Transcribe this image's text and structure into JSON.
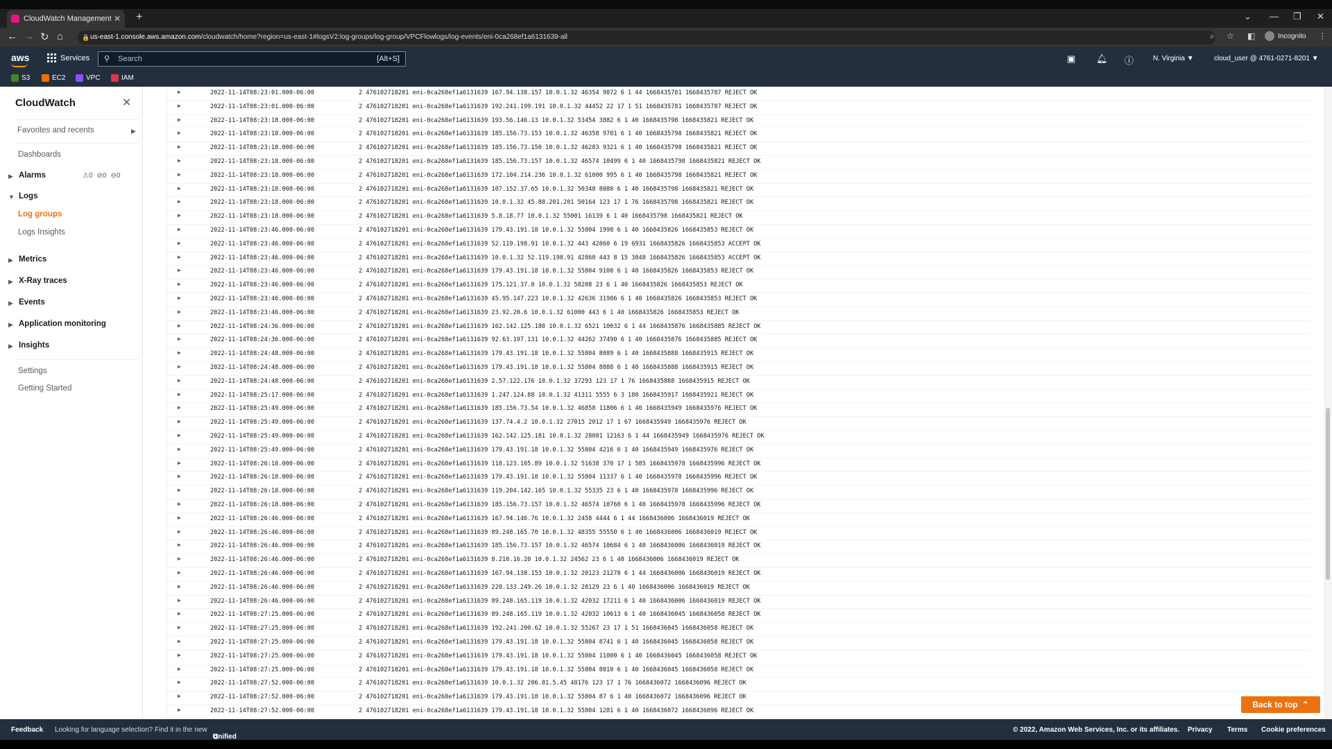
{
  "browser": {
    "tab_title": "CloudWatch Management Cons",
    "new_tab": "+",
    "url_host": "us-east-1.console.aws.amazon.com",
    "url_path": "/cloudwatch/home?region=us-east-1#logsV2:log-groups/log-group/VPCFlowlogs/log-events/eni-0ca268ef1a6131639-all",
    "incognito_label": "Incognito"
  },
  "aws_nav": {
    "logo": "aws",
    "services_label": "Services",
    "search_placeholder": "Search",
    "search_shortcut": "[Alt+S]",
    "region": "N. Virginia ▼",
    "account": "cloud_user @ 4761-0271-8201 ▼"
  },
  "favorites_bar": [
    {
      "label": "S3",
      "color": "#3f8624"
    },
    {
      "label": "EC2",
      "color": "#ed7100"
    },
    {
      "label": "VPC",
      "color": "#8c4fff"
    },
    {
      "label": "IAM",
      "color": "#dd344c"
    }
  ],
  "sidebar": {
    "title": "CloudWatch",
    "favorites": "Favorites and recents",
    "dashboards": "Dashboards",
    "alarms": "Alarms",
    "alarm_counts": [
      "0",
      "0",
      "0"
    ],
    "logs": "Logs",
    "log_groups": "Log groups",
    "logs_insights": "Logs Insights",
    "metrics": "Metrics",
    "xray": "X-Ray traces",
    "events": "Events",
    "app_monitoring": "Application monitoring",
    "insights": "Insights",
    "settings": "Settings",
    "getting_started": "Getting Started"
  },
  "log_events": [
    {
      "ts": "2022-11-14T08:23:01.000-06:00",
      "msg": "2 476102718201 eni-0ca268ef1a6131639 167.94.138.157 10.0.1.32 46354 9872 6 1 44 1668435781 1668435787 REJECT OK"
    },
    {
      "ts": "2022-11-14T08:23:01.000-06:00",
      "msg": "2 476102718201 eni-0ca268ef1a6131639 192.241.199.191 10.0.1.32 44452 22 17 1 51 1668435781 1668435787 REJECT OK"
    },
    {
      "ts": "2022-11-14T08:23:18.000-06:00",
      "msg": "2 476102718201 eni-0ca268ef1a6131639 193.56.146.13 10.0.1.32 53454 3882 6 1 40 1668435798 1668435821 REJECT OK"
    },
    {
      "ts": "2022-11-14T08:23:18.000-06:00",
      "msg": "2 476102718201 eni-0ca268ef1a6131639 185.156.73.153 10.0.1.32 46358 9701 6 1 40 1668435798 1668435821 REJECT OK"
    },
    {
      "ts": "2022-11-14T08:23:18.000-06:00",
      "msg": "2 476102718201 eni-0ca268ef1a6131639 185.156.73.150 10.0.1.32 46283 9321 6 1 40 1668435798 1668435821 REJECT OK"
    },
    {
      "ts": "2022-11-14T08:23:18.000-06:00",
      "msg": "2 476102718201 eni-0ca268ef1a6131639 185.156.73.157 10.0.1.32 46574 10499 6 1 40 1668435798 1668435821 REJECT OK"
    },
    {
      "ts": "2022-11-14T08:23:18.000-06:00",
      "msg": "2 476102718201 eni-0ca268ef1a6131639 172.104.214.236 10.0.1.32 61000 995 6 1 40 1668435798 1668435821 REJECT OK"
    },
    {
      "ts": "2022-11-14T08:23:18.000-06:00",
      "msg": "2 476102718201 eni-0ca268ef1a6131639 107.152.37.65 10.0.1.32 50348 8080 6 1 40 1668435798 1668435821 REJECT OK"
    },
    {
      "ts": "2022-11-14T08:23:18.000-06:00",
      "msg": "2 476102718201 eni-0ca268ef1a6131639 10.0.1.32 45.88.201.201 50164 123 17 1 76 1668435798 1668435821 REJECT OK"
    },
    {
      "ts": "2022-11-14T08:23:18.000-06:00",
      "msg": "2 476102718201 eni-0ca268ef1a6131639 5.8.18.77 10.0.1.32 55001 16139 6 1 40 1668435798 1668435821 REJECT OK"
    },
    {
      "ts": "2022-11-14T08:23:46.000-06:00",
      "msg": "2 476102718201 eni-0ca268ef1a6131639 179.43.191.18 10.0.1.32 55804 1998 6 1 40 1668435826 1668435853 REJECT OK"
    },
    {
      "ts": "2022-11-14T08:23:46.000-06:00",
      "msg": "2 476102718201 eni-0ca268ef1a6131639 52.119.198.91 10.0.1.32 443 42860 6 19 6931 1668435826 1668435853 ACCEPT OK"
    },
    {
      "ts": "2022-11-14T08:23:46.000-06:00",
      "msg": "2 476102718201 eni-0ca268ef1a6131639 10.0.1.32 52.119.198.91 42860 443 8 15 3048 1668435826 1668435853 ACCEPT OK"
    },
    {
      "ts": "2022-11-14T08:23:46.000-06:00",
      "msg": "2 476102718201 eni-0ca268ef1a6131639 179.43.191.18 10.0.1.32 55804 9100 6 1 40 1668435826 1668435853 REJECT OK"
    },
    {
      "ts": "2022-11-14T08:23:46.000-06:00",
      "msg": "2 476102718201 eni-0ca268ef1a6131639 175.121.37.8 10.0.1.32 58208 23 6 1 40 1668435826 1668435853 REJECT OK"
    },
    {
      "ts": "2022-11-14T08:23:46.000-06:00",
      "msg": "2 476102718201 eni-0ca268ef1a6131639 45.95.147.223 10.0.1.32 42636 31986 6 1 40 1668435826 1668435853 REJECT OK"
    },
    {
      "ts": "2022-11-14T08:23:46.000-06:00",
      "msg": "2 476102718201 eni-0ca268ef1a6131639 23.92.20.6 10.0.1.32 61000 443 6 1 40 1668435826 1668435853 REJECT OK"
    },
    {
      "ts": "2022-11-14T08:24:36.000-06:00",
      "msg": "2 476102718201 eni-0ca268ef1a6131639 162.142.125.180 10.0.1.32 6521 10032 6 1 44 1668435876 1668435885 REJECT OK"
    },
    {
      "ts": "2022-11-14T08:24:36.000-06:00",
      "msg": "2 476102718201 eni-0ca268ef1a6131639 92.63.197.131 10.0.1.32 44262 37490 6 1 40 1668435876 1668435885 REJECT OK"
    },
    {
      "ts": "2022-11-14T08:24:48.000-06:00",
      "msg": "2 476102718201 eni-0ca268ef1a6131639 179.43.191.18 10.0.1.32 55804 8089 6 1 40 1668435888 1668435915 REJECT OK"
    },
    {
      "ts": "2022-11-14T08:24:48.000-06:00",
      "msg": "2 476102718201 eni-0ca268ef1a6131639 179.43.191.18 10.0.1.32 55804 8888 6 1 40 1668435888 1668435915 REJECT OK"
    },
    {
      "ts": "2022-11-14T08:24:48.000-06:00",
      "msg": "2 476102718201 eni-0ca268ef1a6131639 2.57.122.176 10.0.1.32 37293 123 17 1 76 1668435888 1668435915 REJECT OK"
    },
    {
      "ts": "2022-11-14T08:25:17.000-06:00",
      "msg": "2 476102718201 eni-0ca268ef1a6131639 1.247.124.88 10.0.1.32 41311 5555 6 3 180 1668435917 1668435921 REJECT OK"
    },
    {
      "ts": "2022-11-14T08:25:49.000-06:00",
      "msg": "2 476102718201 eni-0ca268ef1a6131639 185.156.73.54 10.0.1.32 46858 11806 6 1 40 1668435949 1668435976 REJECT OK"
    },
    {
      "ts": "2022-11-14T08:25:49.000-06:00",
      "msg": "2 476102718201 eni-0ca268ef1a6131639 137.74.4.2 10.0.1.32 27015 2012 17 1 67 1668435949 1668435976 REJECT OK"
    },
    {
      "ts": "2022-11-14T08:25:49.000-06:00",
      "msg": "2 476102718201 eni-0ca268ef1a6131639 162.142.125.181 10.0.1.32 28081 12163 6 1 44 1668435949 1668435976 REJECT OK"
    },
    {
      "ts": "2022-11-14T08:25:49.000-06:00",
      "msg": "2 476102718201 eni-0ca268ef1a6131639 179.43.191.18 10.0.1.32 55804 4216 6 1 40 1668435949 1668435976 REJECT OK"
    },
    {
      "ts": "2022-11-14T08:26:18.000-06:00",
      "msg": "2 476102718201 eni-0ca268ef1a6131639 118.123.105.89 10.0.1.32 51638 370 17 1 585 1668435978 1668435996 REJECT OK"
    },
    {
      "ts": "2022-11-14T08:26:18.000-06:00",
      "msg": "2 476102718201 eni-0ca268ef1a6131639 179.43.191.18 10.0.1.32 55804 11337 6 1 40 1668435978 1668435996 REJECT OK"
    },
    {
      "ts": "2022-11-14T08:26:18.000-06:00",
      "msg": "2 476102718201 eni-0ca268ef1a6131639 119.204.142.165 10.0.1.32 55335 23 6 1 40 1668435978 1668435996 REJECT OK"
    },
    {
      "ts": "2022-11-14T08:26:18.000-06:00",
      "msg": "2 476102718201 eni-0ca268ef1a6131639 185.156.73.157 10.0.1.32 46574 10768 6 1 40 1668435978 1668435996 REJECT OK"
    },
    {
      "ts": "2022-11-14T08:26:46.000-06:00",
      "msg": "2 476102718201 eni-0ca268ef1a6131639 167.94.146.76 10.0.1.32 2458 4444 6 1 44 1668436006 1668436019 REJECT OK"
    },
    {
      "ts": "2022-11-14T08:26:46.000-06:00",
      "msg": "2 476102718201 eni-0ca268ef1a6131639 89.248.165.70 10.0.1.32 48355 55550 6 1 40 1668436006 1668436019 REJECT OK"
    },
    {
      "ts": "2022-11-14T08:26:46.000-06:00",
      "msg": "2 476102718201 eni-0ca268ef1a6131639 185.156.73.157 10.0.1.32 46574 10684 6 1 40 1668436006 1668436019 REJECT OK"
    },
    {
      "ts": "2022-11-14T08:26:46.000-06:00",
      "msg": "2 476102718201 eni-0ca268ef1a6131639 8.210.16.20 10.0.1.32 24562 23 6 1 40 1668436006 1668436019 REJECT OK"
    },
    {
      "ts": "2022-11-14T08:26:46.000-06:00",
      "msg": "2 476102718201 eni-0ca268ef1a6131639 167.94.138.153 10.0.1.32 20123 21278 6 1 44 1668436006 1668436019 REJECT OK"
    },
    {
      "ts": "2022-11-14T08:26:46.000-06:00",
      "msg": "2 476102718201 eni-0ca268ef1a6131639 220.133.249.26 10.0.1.32 28129 23 6 1 40 1668436006 1668436019 REJECT OK"
    },
    {
      "ts": "2022-11-14T08:26:46.000-06:00",
      "msg": "2 476102718201 eni-0ca268ef1a6131639 89.248.165.119 10.0.1.32 42032 17211 6 1 40 1668436006 1668436019 REJECT OK"
    },
    {
      "ts": "2022-11-14T08:27:25.000-06:00",
      "msg": "2 476102718201 eni-0ca268ef1a6131639 89.248.165.119 10.0.1.32 42032 10613 6 1 40 1668436045 1668436058 REJECT OK"
    },
    {
      "ts": "2022-11-14T08:27:25.000-06:00",
      "msg": "2 476102718201 eni-0ca268ef1a6131639 192.241.200.62 10.0.1.32 55267 23 17 1 51 1668436045 1668436058 REJECT OK"
    },
    {
      "ts": "2022-11-14T08:27:25.000-06:00",
      "msg": "2 476102718201 eni-0ca268ef1a6131639 179.43.191.18 10.0.1.32 55804 8741 6 1 40 1668436045 1668436058 REJECT OK"
    },
    {
      "ts": "2022-11-14T08:27:25.000-06:00",
      "msg": "2 476102718201 eni-0ca268ef1a6131639 179.43.191.18 10.0.1.32 55804 11000 6 1 40 1668436045 1668436058 REJECT OK"
    },
    {
      "ts": "2022-11-14T08:27:25.000-06:00",
      "msg": "2 476102718201 eni-0ca268ef1a6131639 179.43.191.18 10.0.1.32 55804 8010 6 1 40 1668436045 1668436058 REJECT OK"
    },
    {
      "ts": "2022-11-14T08:27:52.000-06:00",
      "msg": "2 476102718201 eni-0ca268ef1a6131639 10.0.1.32 206.81.5.45 48176 123 17 1 76 1668436072 1668436096 REJECT OK"
    },
    {
      "ts": "2022-11-14T08:27:52.000-06:00",
      "msg": "2 476102718201 eni-0ca268ef1a6131639 179.43.191.18 10.0.1.32 55804 87 6 1 40 1668436072 1668436096 REJECT OK"
    },
    {
      "ts": "2022-11-14T08:27:52.000-06:00",
      "msg": "2 476102718201 eni-0ca268ef1a6131639 179.43.191.18 10.0.1.32 55804 1281 6 1 40 1668436072 1668436096 REJECT OK"
    }
  ],
  "back_to_top": "Back to top",
  "footer": {
    "feedback": "Feedback",
    "language_note": "Looking for language selection? Find it in the new",
    "unified_settings": "Unified Settings",
    "copyright": "© 2022, Amazon Web Services, Inc. or its affiliates.",
    "privacy": "Privacy",
    "terms": "Terms",
    "cookies": "Cookie preferences"
  }
}
